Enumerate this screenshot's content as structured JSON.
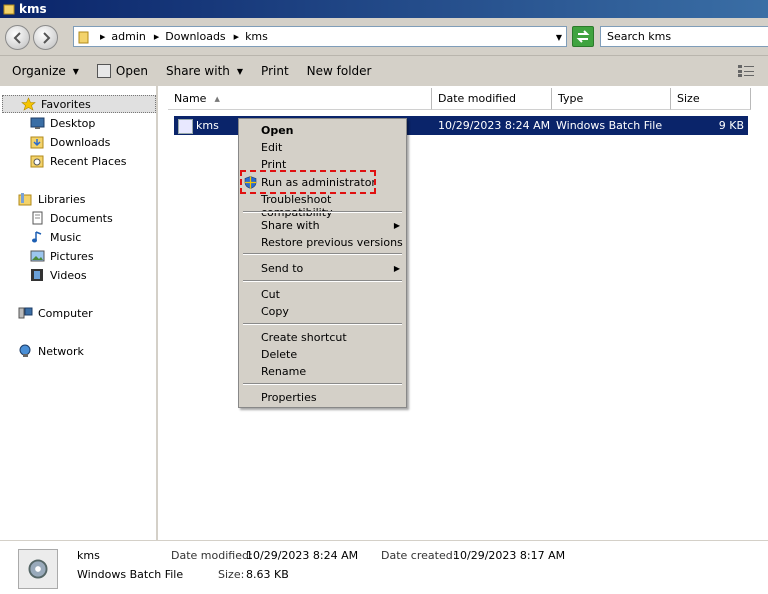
{
  "window": {
    "title": "kms"
  },
  "address": {
    "crumbs": [
      "admin",
      "Downloads",
      "kms"
    ],
    "search_placeholder": "Search kms"
  },
  "toolbar": {
    "organize": "Organize",
    "open": "Open",
    "share_with": "Share with",
    "print": "Print",
    "new_folder": "New folder"
  },
  "nav": {
    "favorites": "Favorites",
    "desktop": "Desktop",
    "downloads": "Downloads",
    "recent_places": "Recent Places",
    "libraries": "Libraries",
    "documents": "Documents",
    "music": "Music",
    "pictures": "Pictures",
    "videos": "Videos",
    "computer": "Computer",
    "network": "Network"
  },
  "columns": {
    "name": "Name",
    "date_modified": "Date modified",
    "type": "Type",
    "size": "Size"
  },
  "file": {
    "name": "kms",
    "date_modified": "10/29/2023 8:24 AM",
    "type": "Windows Batch File",
    "size": "9 KB"
  },
  "context_menu": {
    "open": "Open",
    "edit": "Edit",
    "print": "Print",
    "run_as_admin": "Run as administrator",
    "troubleshoot": "Troubleshoot compatibility",
    "share_with": "Share with",
    "restore": "Restore previous versions",
    "send_to": "Send to",
    "cut": "Cut",
    "copy": "Copy",
    "create_shortcut": "Create shortcut",
    "delete": "Delete",
    "rename": "Rename",
    "properties": "Properties"
  },
  "details": {
    "name": "kms",
    "type": "Windows Batch File",
    "date_modified_label": "Date modified:",
    "date_modified": "10/29/2023 8:24 AM",
    "date_created_label": "Date created:",
    "date_created": "10/29/2023 8:17 AM",
    "size_label": "Size:",
    "size": "8.63 KB"
  }
}
